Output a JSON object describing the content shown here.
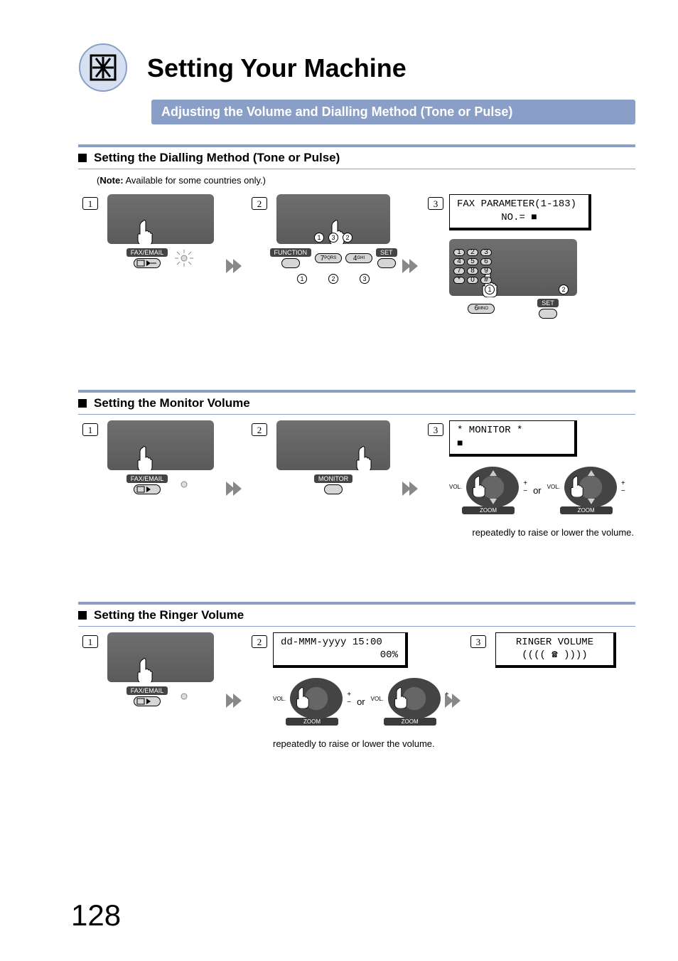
{
  "header": {
    "title": "Setting Your Machine",
    "subtitle": "Adjusting the Volume and Dialling Method (Tone or Pulse)"
  },
  "section1": {
    "heading": "Setting the Dialling Method (Tone or Pulse)",
    "note_prefix": "Note:",
    "note_body": " Available for some countries only.)",
    "step1_label": "FAX/EMAIL",
    "step2_label_left": "FUNCTION",
    "step2_key1": "7",
    "step2_key1_sub": "PQRS",
    "step2_key2": "4",
    "step2_key2_sub": "GHI",
    "step2_label_right": "SET",
    "lcd_line1": "FAX PARAMETER(1-183)",
    "lcd_line2": "NO.= ■",
    "step3_key": "6",
    "step3_key_sub": "MNO",
    "step3_set": "SET"
  },
  "section2": {
    "heading": "Setting the Monitor Volume",
    "step1_label": "FAX/EMAIL",
    "step2_label": "MONITOR",
    "lcd_line1": "* MONITOR *",
    "lcd_line2": "■",
    "vol": "VOL.",
    "zoom": "ZOOM",
    "or": "or",
    "caption": "repeatedly to raise or lower the volume."
  },
  "section3": {
    "heading": "Setting the Ringer Volume",
    "step1_label": "FAX/EMAIL",
    "lcd1_line1": "dd-MMM-yyyy 15:00",
    "lcd1_line2": "00%",
    "vol": "VOL.",
    "zoom": "ZOOM",
    "or": "or",
    "caption": "repeatedly to raise or lower the volume.",
    "lcd2_line1": "RINGER VOLUME",
    "lcd2_line2": "((((  ☎  ))))"
  },
  "page_number": "128"
}
